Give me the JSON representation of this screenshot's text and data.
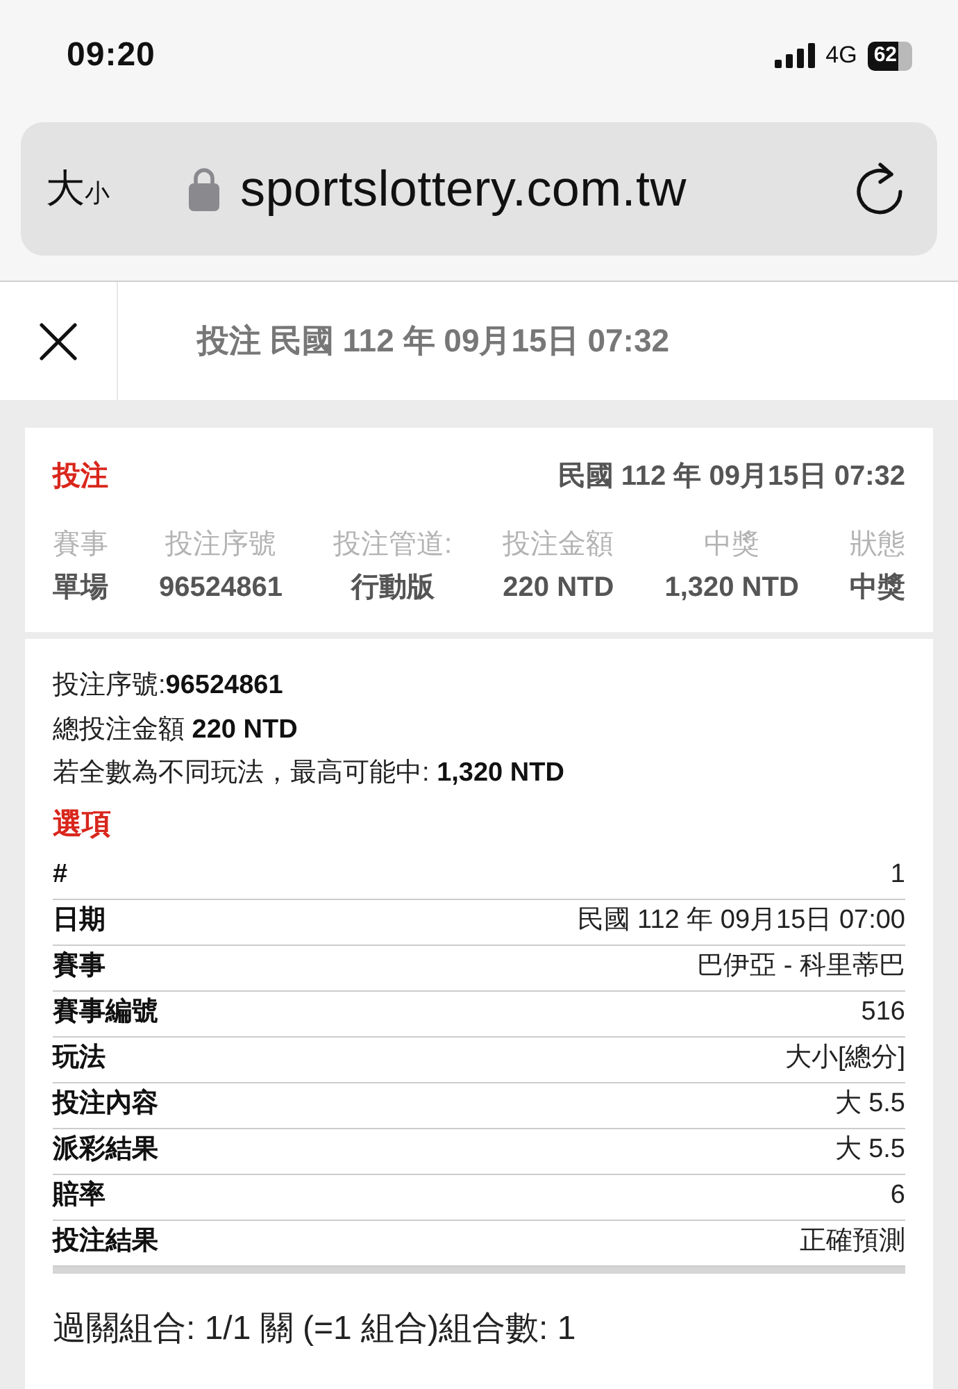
{
  "status_bar": {
    "time": "09:20",
    "network": "4G",
    "battery": "62"
  },
  "address_bar": {
    "text_size_button": {
      "large": "大",
      "small": "小"
    },
    "url": "sportslottery.com.tw"
  },
  "page_header": {
    "title": "投注 民國 112 年 09月15日 07:32"
  },
  "bet_card": {
    "heading": "投注",
    "timestamp": "民國 112 年 09月15日 07:32",
    "summary": [
      {
        "label": "賽事",
        "value": "單場"
      },
      {
        "label": "投注序號",
        "value": "96524861"
      },
      {
        "label": "投注管道:",
        "value": "行動版"
      },
      {
        "label": "投注金額",
        "value": "220 NTD"
      },
      {
        "label": "中獎",
        "value": "1,320 NTD"
      },
      {
        "label": "狀態",
        "value": "中獎"
      }
    ]
  },
  "detail_card": {
    "lines": [
      "投注序號:**96524861**",
      "總投注金額 **220 NTD**",
      "若全數為不同玩法，最高可能中: **1,320 NTD**"
    ],
    "section_title": "選項",
    "rows": [
      {
        "label": "#",
        "value": "1"
      },
      {
        "label": "日期",
        "value": "民國 112 年 09月15日 07:00"
      },
      {
        "label": "賽事",
        "value": "巴伊亞 - 科里蒂巴"
      },
      {
        "label": "賽事編號",
        "value": "516"
      },
      {
        "label": "玩法",
        "value": "大小[總分]"
      },
      {
        "label": "投注內容",
        "value": "大 5.5"
      },
      {
        "label": "派彩結果",
        "value": "大 5.5"
      },
      {
        "label": "賠率",
        "value": "6"
      },
      {
        "label": "投注結果",
        "value": "正確預測"
      }
    ],
    "footer": "過關組合: 1/1 關 (=1 組合)組合數: 1"
  }
}
